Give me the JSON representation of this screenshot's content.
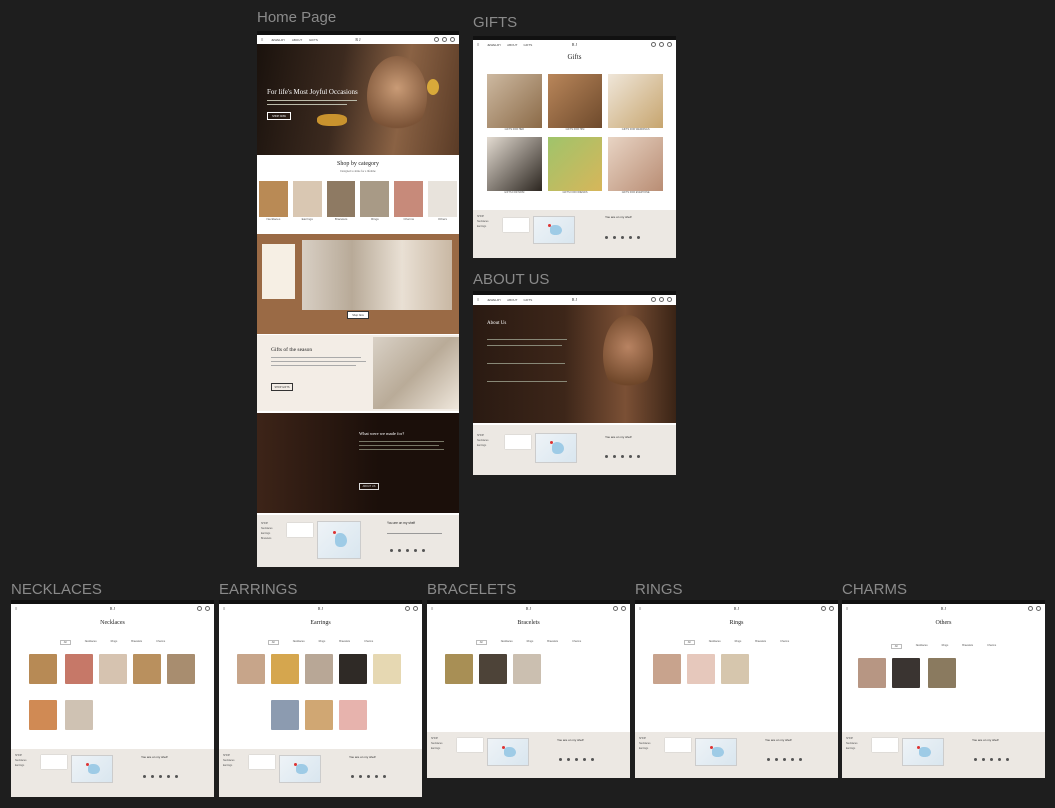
{
  "frame_titles": {
    "home": "Home Page",
    "gifts": "GIFTS",
    "about": "ABOUT US",
    "necklaces": "NECKLACES",
    "earrings": "EARRINGS",
    "bracelets": "BRACELETS",
    "rings": "RINGS",
    "charms": "CHARMS"
  },
  "nav": {
    "logo": "R J",
    "links": [
      "JEWELRY",
      "ABOUT",
      "GIFTS"
    ]
  },
  "home": {
    "hero_heading": "For life's Most Joyful Occasions",
    "hero_cta": "SHOP NOW",
    "shop_by_category": "Shop by category",
    "category_sub": "Designed to shine for a lifetime",
    "categories": [
      "Necklaces",
      "Earrings",
      "Bracelets",
      "Rings",
      "Charms",
      "Others"
    ],
    "collage_cta": "Shop Now",
    "gifts_heading": "Gifts of the season",
    "gifts_cta": "SHOP GIFTS",
    "story_heading": "What were we made for?",
    "story_cta": "ABOUT US"
  },
  "gifts": {
    "heading": "Gifts",
    "items": [
      "GIFTS FOR HER",
      "GIFTS FOR HIM",
      "GIFTS FOR WEDDINGS",
      "GIFTS FOR MOM",
      "GIFTS FOR FRIENDS",
      "GIFTS FOR EVERYONE"
    ]
  },
  "about": {
    "heading": "About Us"
  },
  "footer": {
    "newsletter_title": "You are on my shelf",
    "newsletter_alt": "Be on the first to know",
    "links": [
      "SHOP",
      "Necklaces",
      "Earrings",
      "Bracelets",
      "Rings",
      "Charms"
    ]
  },
  "pages": {
    "necklaces": "Necklaces",
    "earrings": "Earrings",
    "bracelets": "Bracelets",
    "rings": "Rings",
    "charms": "Others"
  },
  "filters": [
    "All",
    "Necklaces",
    "Rings",
    "Bracelets",
    "Charms"
  ],
  "colors": {
    "canvas": "#1e1e1e",
    "title": "#8a8a8a",
    "footer": "#ece8e3",
    "brown": "#7a4a2a"
  }
}
